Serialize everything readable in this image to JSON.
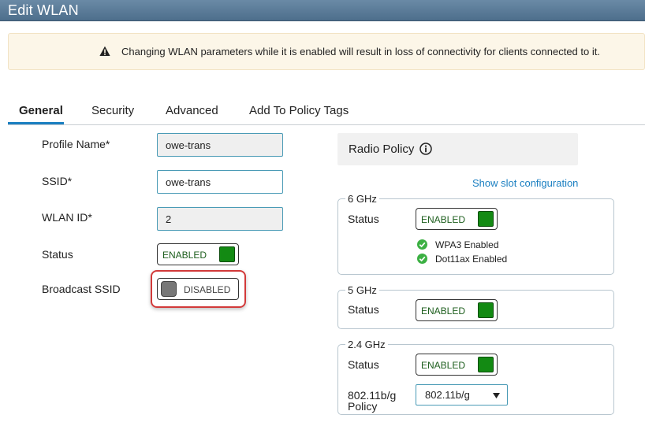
{
  "window": {
    "title": "Edit WLAN"
  },
  "warning": {
    "text": "Changing WLAN parameters while it is enabled will result in loss of connectivity for clients connected to it."
  },
  "tabs": [
    {
      "label": "General",
      "active": true
    },
    {
      "label": "Security",
      "active": false
    },
    {
      "label": "Advanced",
      "active": false
    },
    {
      "label": "Add To Policy Tags",
      "active": false
    }
  ],
  "general": {
    "profile_name": {
      "label": "Profile Name*",
      "value": "owe-trans"
    },
    "ssid": {
      "label": "SSID*",
      "value": "owe-trans"
    },
    "wlan_id": {
      "label": "WLAN ID*",
      "value": "2"
    },
    "status": {
      "label": "Status",
      "state": "ENABLED"
    },
    "broadcast_ssid": {
      "label": "Broadcast SSID",
      "state": "DISABLED"
    }
  },
  "radio_policy": {
    "title": "Radio Policy",
    "show_slot_link": "Show slot configuration",
    "bands": [
      {
        "legend": "6 GHz",
        "status_label": "Status",
        "state": "ENABLED",
        "checks": [
          "WPA3 Enabled",
          "Dot11ax Enabled"
        ]
      },
      {
        "legend": "5 GHz",
        "status_label": "Status",
        "state": "ENABLED"
      },
      {
        "legend": "2.4 GHz",
        "status_label": "Status",
        "state": "ENABLED",
        "policy_label_line1": "802.11b/g",
        "policy_label_line2": "Policy",
        "policy_value": "802.11b/g"
      }
    ]
  },
  "colors": {
    "accent": "#1a7fc1",
    "enabled_green": "#138a13",
    "highlight_red": "#d23a3a",
    "warning_bg": "#fcf6e8"
  },
  "icons": {
    "warning": "warning-triangle-icon",
    "info": "info-circle-icon",
    "check": "check-circle-icon",
    "caret": "chevron-down-icon"
  }
}
